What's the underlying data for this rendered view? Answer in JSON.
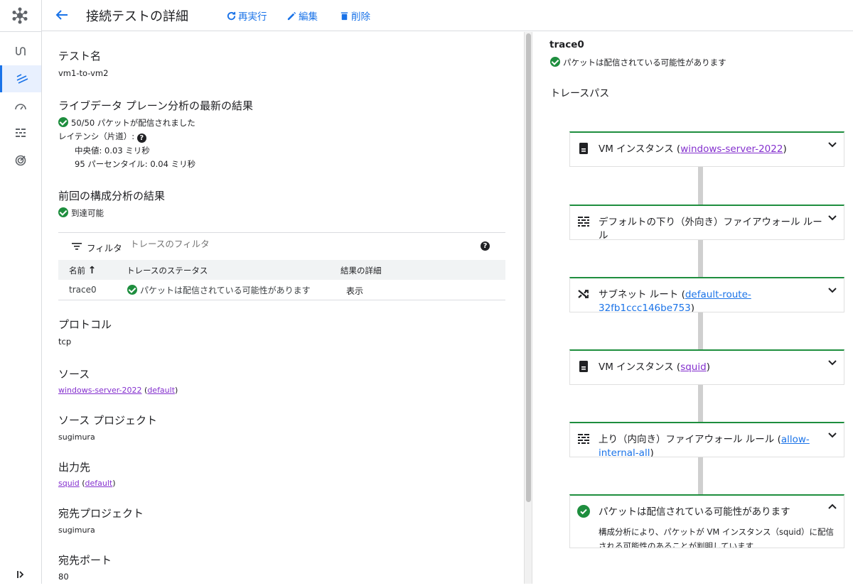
{
  "header": {
    "title": "接続テストの詳細",
    "rerun_label": "再実行",
    "edit_label": "編集",
    "delete_label": "削除"
  },
  "left": {
    "test_name_h": "テスト名",
    "test_name_v": "vm1-to-vm2",
    "live_h": "ライブデータ プレーン分析の最新の結果",
    "live_packets": "50/50 パケットが配信されました",
    "latency_label": "レイテンシ（片道）:",
    "median": "中央値: 0.03 ミリ秒",
    "p95": "95 パーセンタイル: 0.04 ミリ秒",
    "config_h": "前回の構成分析の結果",
    "reachable": "到達可能",
    "filter_label": "フィルタ",
    "filter_placeholder": "トレースのフィルタ",
    "table": {
      "col_name": "名前",
      "col_status": "トレースのステータス",
      "col_detail": "結果の詳細",
      "rows": [
        {
          "name": "trace0",
          "status": "パケットは配信されている可能性があります",
          "detail": "表示"
        }
      ]
    },
    "protocol_h": "プロトコル",
    "protocol_v": "tcp",
    "source_h": "ソース",
    "source_link": "windows-server-2022",
    "source_net": "default",
    "source_proj_h": "ソース プロジェクト",
    "source_proj_v": "sugimura",
    "dest_h": "出力先",
    "dest_link": "squid",
    "dest_net": "default",
    "dest_proj_h": "宛先プロジェクト",
    "dest_proj_v": "sugimura",
    "dest_port_h": "宛先ポート",
    "dest_port_v": "80"
  },
  "right": {
    "trace_title": "trace0",
    "trace_status": "パケットは配信されている可能性があります",
    "trace_path_label": "トレースパス",
    "cards": [
      {
        "prefix": "VM インスタンス (",
        "link": "windows-server-2022",
        "suffix": ")",
        "icon": "vm-icon"
      },
      {
        "prefix": "デフォルトの下り（外向き）ファイアウォール ルール",
        "link": "",
        "suffix": "",
        "icon": "firewall-icon"
      },
      {
        "prefix": "サブネット ルート (",
        "link": "default-route-32fb1ccc146be753",
        "suffix": ")",
        "icon": "route-icon"
      },
      {
        "prefix": "VM インスタンス (",
        "link": "squid",
        "suffix": ")",
        "icon": "vm-icon"
      },
      {
        "prefix": "上り（内向き）ファイアウォール ルール (",
        "link": "allow-internal-all",
        "suffix": ")",
        "icon": "firewall-icon"
      },
      {
        "prefix": "パケットは配信されている可能性があります",
        "link": "",
        "suffix": "",
        "icon": "check-icon",
        "detail": "構成分析により、パケットが VM インスタンス（squid）に配信される可能性のあることが判明しています"
      }
    ]
  },
  "colors": {
    "accent": "#1a73e8",
    "success": "#1e8e3e",
    "link": "#8430ce"
  }
}
